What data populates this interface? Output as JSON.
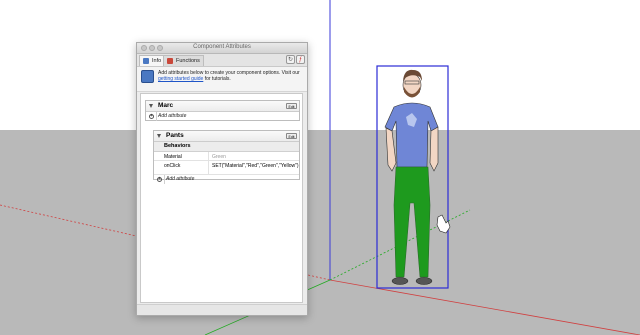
{
  "dialog": {
    "title": "Component Attributes",
    "tabs": [
      {
        "label": "Info",
        "icon": "info-icon"
      },
      {
        "label": "Functions",
        "icon": "functions-icon"
      }
    ],
    "toolbar_icons": [
      "refresh-icon",
      "toggle-formula-icon"
    ],
    "intro": {
      "text_before": "Add attributes below to create your component options. Visit our",
      "link_text": "getting started guide",
      "text_after": "for tutorials."
    }
  },
  "components": [
    {
      "name": "Marc",
      "edit_label": "Edit",
      "add_attribute_label": "Add attribute"
    },
    {
      "name": "Pants",
      "edit_label": "Edit",
      "group": "Behaviors",
      "attributes": [
        {
          "name": "Material",
          "value": "Green"
        },
        {
          "name": "onClick",
          "value": "SET(\"Material\",\"Red\",\"Green\",\"Yellow\")"
        }
      ],
      "add_attribute_label": "Add attribute"
    }
  ],
  "scene": {
    "sky_color": "#ffffff",
    "ground_color": "#b9b9b9",
    "selection_color": "#2b2bd6",
    "shirt_color": "#6f86d6",
    "pants_color": "#1e9a1e"
  }
}
